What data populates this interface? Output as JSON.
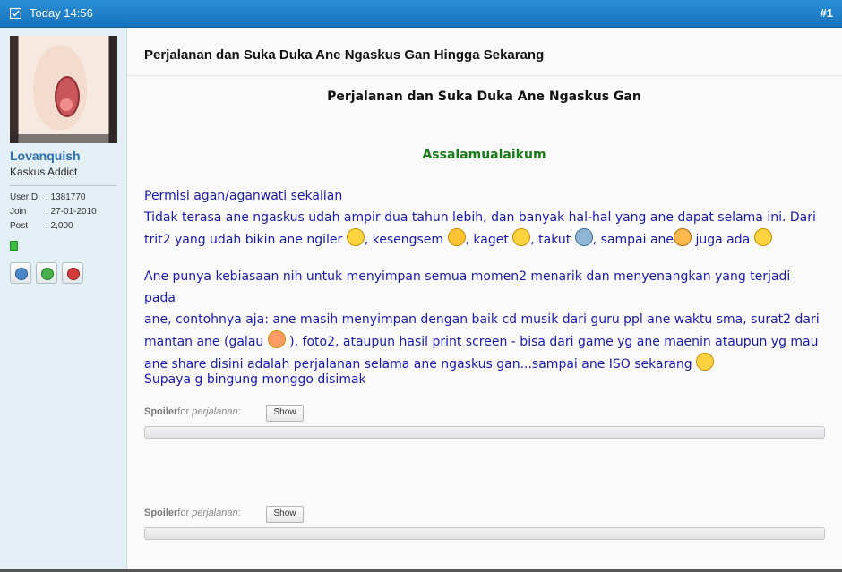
{
  "header": {
    "date": "Today 14:56",
    "post_number": "#1"
  },
  "user": {
    "name": "Lovanquish",
    "rank": "Kaskus Addict",
    "stats": [
      {
        "label": "UserID",
        "value": ": 1381770"
      },
      {
        "label": "Join",
        "value": ": 27-01-2010"
      },
      {
        "label": "Post",
        "value": ": 2,000"
      }
    ]
  },
  "post": {
    "thread_title": "Perjalanan dan Suka Duka Ane Ngaskus Gan Hingga Sekarang",
    "heading": "Perjalanan dan Suka Duka Ane Ngaskus Gan",
    "greeting": "Assalamualaikum",
    "p1_line1": "Permisi agan/aganwati sekalian",
    "p1_line2": "Tidak terasa ane ngaskus udah ampir dua tahun lebih, dan banyak hal-hal yang ane dapat selama ini. Dari",
    "p1_line3_a": "trit2 yang udah bikin ane ngiler ",
    "p1_line3_b": ", kesengsem ",
    "p1_line3_c": ", kaget ",
    "p1_line3_d": ", takut ",
    "p1_line3_e": ", sampai ane",
    "p1_line3_f": " juga ada ",
    "p2_line1": "Ane punya kebiasaan nih untuk menyimpan semua momen2 menarik dan menyenangkan yang terjadi pada",
    "p2_line2": "ane, contohnya aja: ane masih menyimpan dengan baik cd musik dari guru ppl ane waktu sma, surat2 dari",
    "p2_line3_a": "mantan ane (galau ",
    "p2_line3_b": " ), foto2, ataupun hasil print screen - bisa dari game yg ane maenin ataupun yg mau",
    "p2_line4": "ane share disini adalah perjalanan selama ane ngaskus gan...sampai ane ISO sekarang ",
    "p3": "Supaya g bingung monggo disimak",
    "spoilers": [
      {
        "word": "Spoiler",
        "for": "for ",
        "title": "perjalanan",
        "colon": ":",
        "button": "Show"
      },
      {
        "word": "Spoiler",
        "for": "for ",
        "title": "perjalanan",
        "colon": ":",
        "button": "Show"
      }
    ]
  },
  "colors": {
    "header_blue": "#1a7dc8",
    "text_blue": "#1a1aa8",
    "greeting_green": "#1a7a1a",
    "username_blue": "#2a6fb0"
  },
  "icons": [
    "calendar-icon",
    "avatar-image",
    "online-status-icon",
    "view-profile-icon",
    "add-reputation-icon",
    "report-icon",
    "smiley-drool-icon",
    "smiley-love-icon",
    "smiley-shock-icon",
    "smiley-scared-icon",
    "smiley-bird-icon",
    "smiley-grin-icon",
    "smiley-galau-icon"
  ]
}
